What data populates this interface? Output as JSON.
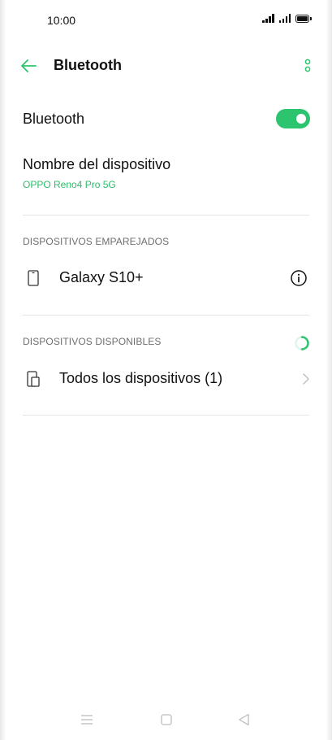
{
  "status_bar": {
    "time": "10:00",
    "icons": [
      "signal-icon",
      "signal-icon",
      "battery-icon"
    ]
  },
  "app_bar": {
    "title": "Bluetooth",
    "back_icon": "arrow-left-icon",
    "more_icon": "more-vertical-icon"
  },
  "bluetooth_toggle": {
    "label": "Bluetooth",
    "enabled": true
  },
  "device_name": {
    "label": "Nombre del dispositivo",
    "value": "OPPO Reno4 Pro 5G"
  },
  "paired": {
    "header": "DISPOSITIVOS EMPAREJADOS",
    "items": [
      {
        "label": "Galaxy S10+",
        "icon": "phone-icon",
        "action_icon": "info-icon"
      }
    ]
  },
  "available": {
    "header": "DISPOSITIVOS DISPONIBLES",
    "loading_icon": "spinner-icon",
    "items": [
      {
        "label": "Todos los dispositivos (1)",
        "icon": "devices-icon",
        "action_icon": "chevron-right-icon"
      }
    ]
  },
  "nav_bar": {
    "items": [
      "menu-icon",
      "home-icon",
      "back-triangle-icon"
    ]
  },
  "colors": {
    "accent": "#2dc46f",
    "secondary_text": "#6f6f6f",
    "divider": "#e4e4e4"
  }
}
